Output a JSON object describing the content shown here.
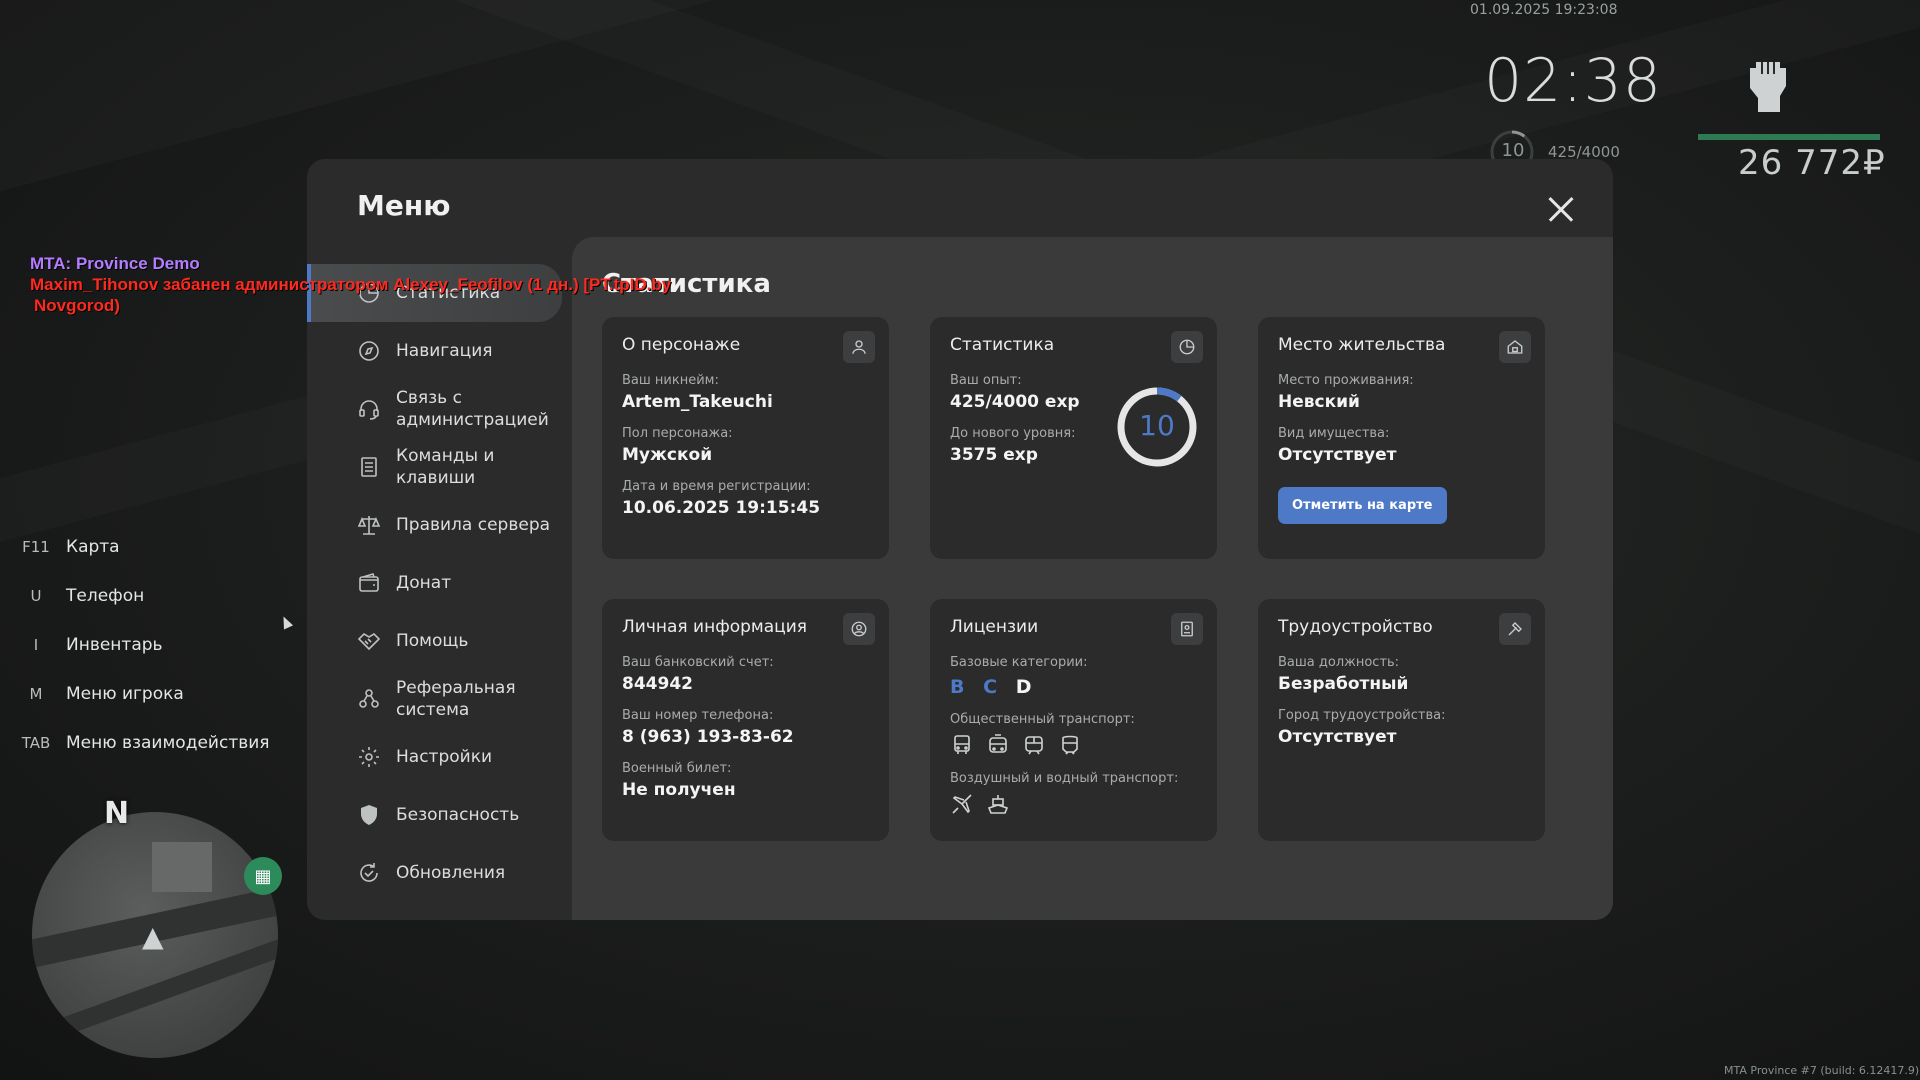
{
  "hud": {
    "datetime": "01.09.2025 19:23:08",
    "time": "02:38",
    "level": "10",
    "exp": "425/4000",
    "money": "26 772₽",
    "health_fraction": 1.0
  },
  "chat": {
    "line1": "MTA: Province Demo",
    "line2": "Maxim_Tihonov забанен администратором Alexey_Feofilov (1 дн.) [PT.tpID.by",
    "line3": "Novgorod)"
  },
  "hotkeys": [
    {
      "key": "F11",
      "label": "Карта"
    },
    {
      "key": "U",
      "label": "Телефон"
    },
    {
      "key": "I",
      "label": "Инвентарь"
    },
    {
      "key": "M",
      "label": "Меню игрока"
    },
    {
      "key": "TAB",
      "label": "Меню взаимодействия"
    }
  ],
  "minimap": {
    "north": "N"
  },
  "menu": {
    "title": "Меню",
    "nav": [
      {
        "label": "Статистика",
        "icon": "chart-pie-icon",
        "active": true
      },
      {
        "label": "Навигация",
        "icon": "compass-icon"
      },
      {
        "label": "Связь с администрацией",
        "icon": "headset-icon"
      },
      {
        "label": "Команды и клавиши",
        "icon": "list-icon"
      },
      {
        "label": "Правила сервера",
        "icon": "scales-icon"
      },
      {
        "label": "Донат",
        "icon": "wallet-icon"
      },
      {
        "label": "Помощь",
        "icon": "handshake-icon"
      },
      {
        "label": "Реферальная система",
        "icon": "people-icon"
      },
      {
        "label": "Настройки",
        "icon": "gear-icon"
      },
      {
        "label": "Безопасность",
        "icon": "shield-icon"
      },
      {
        "label": "Обновления",
        "icon": "refresh-icon"
      }
    ],
    "content_title": "Статистика",
    "cards": {
      "character": {
        "title": "О персонаже",
        "nick_label": "Ваш никнейм:",
        "nick": "Artem_Takeuchi",
        "sex_label": "Пол персонажа:",
        "sex": "Мужской",
        "reg_label": "Дата и время регистрации:",
        "reg": "10.06.2025 19:15:45"
      },
      "stats": {
        "title": "Статистика",
        "exp_label": "Ваш опыт:",
        "exp": "425/4000 exp",
        "next_label": "До нового уровня:",
        "next": "3575 exp",
        "level": "10",
        "progress_fraction": 0.106
      },
      "residence": {
        "title": "Место жительства",
        "place_label": "Место проживания:",
        "place": "Невский",
        "property_label": "Вид имущества:",
        "property": "Отсутствует",
        "button": "Отметить на карте"
      },
      "personal": {
        "title": "Личная информация",
        "bank_label": "Ваш банковский счет:",
        "bank": "844942",
        "phone_label": "Ваш номер телефона:",
        "phone": "8 (963) 193-83-62",
        "military_label": "Военный билет:",
        "military": "Не получен"
      },
      "licenses": {
        "title": "Лицензии",
        "base_label": "Базовые категории:",
        "cats": [
          {
            "name": "B",
            "owned": true
          },
          {
            "name": "C",
            "owned": true
          },
          {
            "name": "D",
            "owned": false
          }
        ],
        "public_label": "Общественный транспорт:",
        "air_label": "Воздушный и водный транспорт:"
      },
      "job": {
        "title": "Трудоустройство",
        "position_label": "Ваша должность:",
        "position": "Безработный",
        "city_label": "Город трудоустройства:",
        "city": "Отсутствует"
      }
    }
  },
  "build": "MTA Province #7 (build: 6.12417.9)",
  "colors": {
    "accent": "#4d79c7",
    "health": "#2d7a55"
  }
}
